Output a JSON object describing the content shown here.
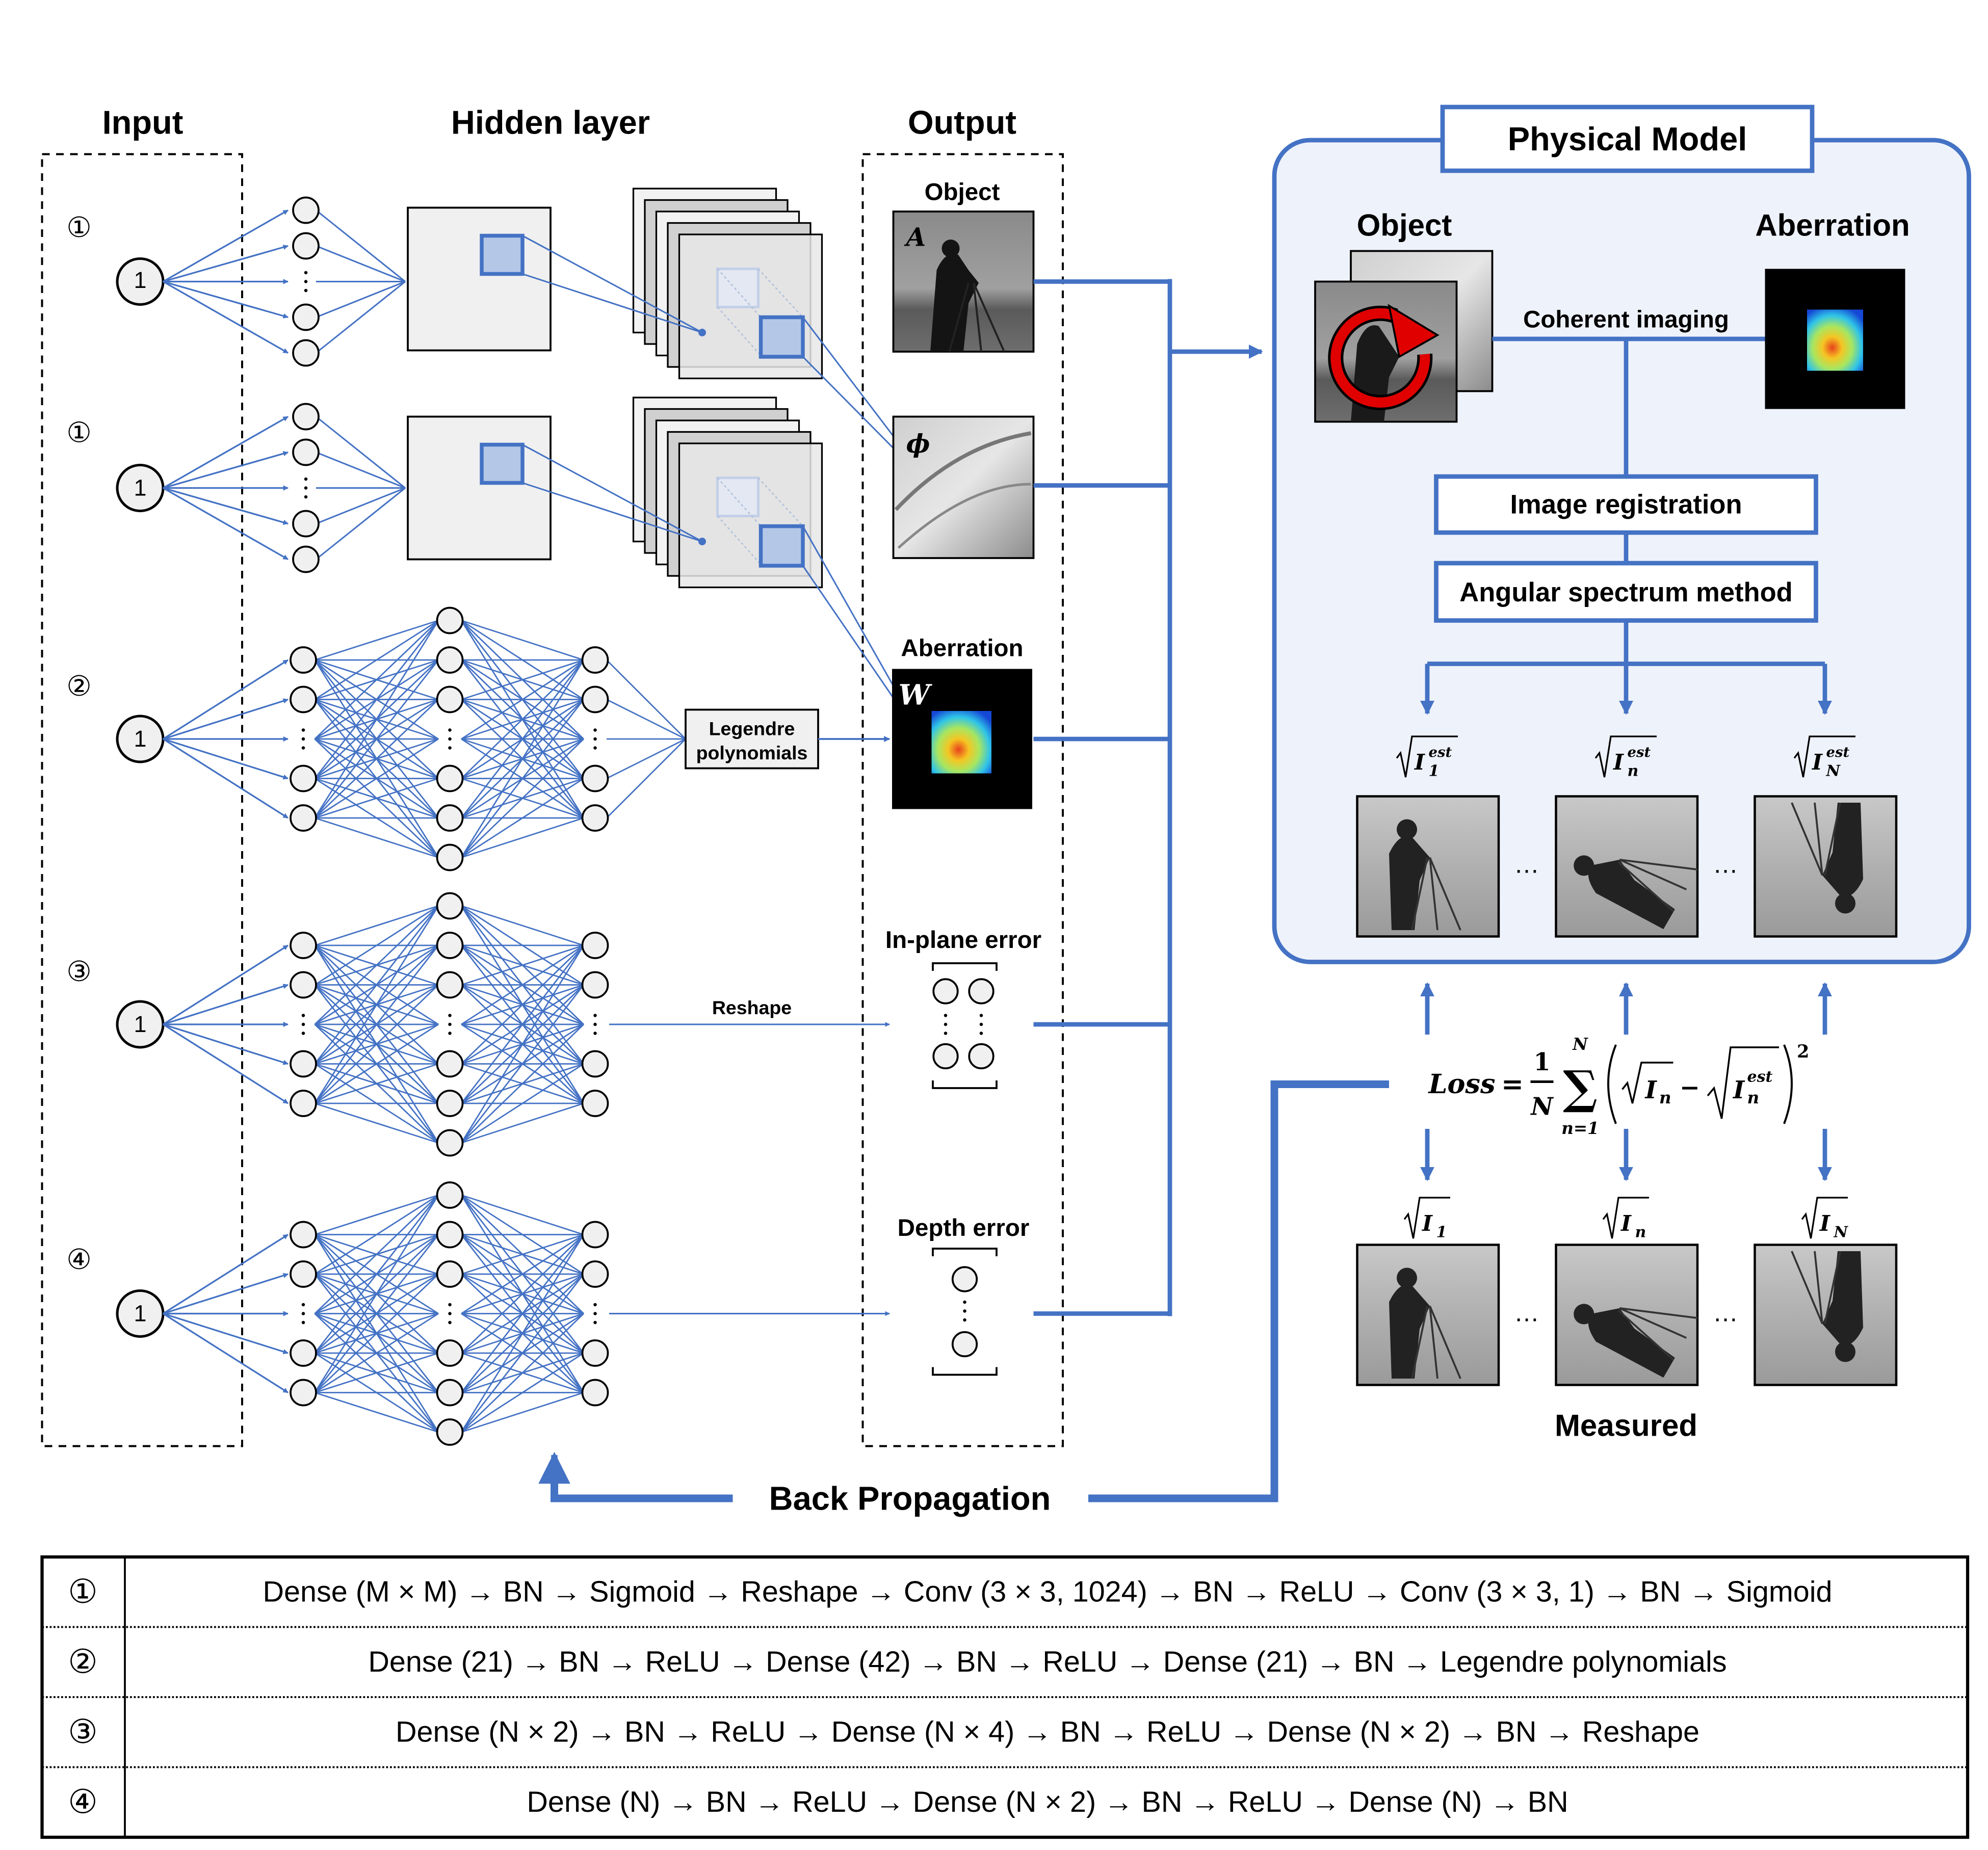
{
  "headers": {
    "input": "Input",
    "hidden": "Hidden layer",
    "output": "Output"
  },
  "branch_markers": [
    "①",
    "①",
    "②",
    "③",
    "④"
  ],
  "input_node_label": "1",
  "output": {
    "object_label": "Object",
    "amplitude_symbol": "A",
    "phase_symbol": "ϕ",
    "aberration_label": "Aberration",
    "aberration_symbol": "W",
    "legendre_box": [
      "Legendre",
      "polynomials"
    ],
    "inplane_label": "In-plane error",
    "reshape_label": "Reshape",
    "depth_label": "Depth error"
  },
  "physical_model": {
    "title": "Physical Model",
    "object_label": "Object",
    "aberration_label": "Aberration",
    "coherent_label": "Coherent imaging",
    "registration_label": "Image registration",
    "asm_label": "Angular spectrum method",
    "estimates": [
      {
        "base": "I",
        "sub": "1",
        "sup": "est"
      },
      {
        "base": "I",
        "sub": "n",
        "sup": "est"
      },
      {
        "base": "I",
        "sub": "N",
        "sup": "est"
      }
    ],
    "ellipsis": "…"
  },
  "loss": {
    "lhs": "Loss",
    "eq": "=",
    "frac_num": "1",
    "frac_den": "N",
    "sum_top": "N",
    "sum_bottom": "n=1",
    "term1": {
      "base": "I",
      "sub": "n"
    },
    "minus": "−",
    "term2": {
      "base": "I",
      "sub": "n",
      "sup": "est"
    },
    "power": "2"
  },
  "measured": {
    "labels": [
      {
        "base": "I",
        "sub": "1"
      },
      {
        "base": "I",
        "sub": "n"
      },
      {
        "base": "I",
        "sub": "N"
      }
    ],
    "caption": "Measured"
  },
  "backprop_label": "Back Propagation",
  "table": {
    "rows": [
      {
        "marker": "①",
        "text": "Dense (M × M) → BN → Sigmoid → Reshape → Conv (3 × 3, 1024) → BN → ReLU → Conv (3 × 3, 1) → BN → Sigmoid"
      },
      {
        "marker": "②",
        "text": "Dense (21) → BN → ReLU → Dense (42) → BN → ReLU → Dense (21) → BN → Legendre polynomials"
      },
      {
        "marker": "③",
        "text": "Dense (N × 2) → BN → ReLU → Dense (N × 4) → BN → ReLU → Dense (N × 2) → BN → Reshape"
      },
      {
        "marker": "④",
        "text": "Dense (N) → BN → ReLU → Dense (N × 2) → BN → ReLU → Dense (N) → BN"
      }
    ]
  },
  "colors": {
    "accent": "#4472c4",
    "accent_light": "#b4c7e7",
    "panel_bg": "#eef2fa",
    "node_fill": "#f0f0f0"
  }
}
